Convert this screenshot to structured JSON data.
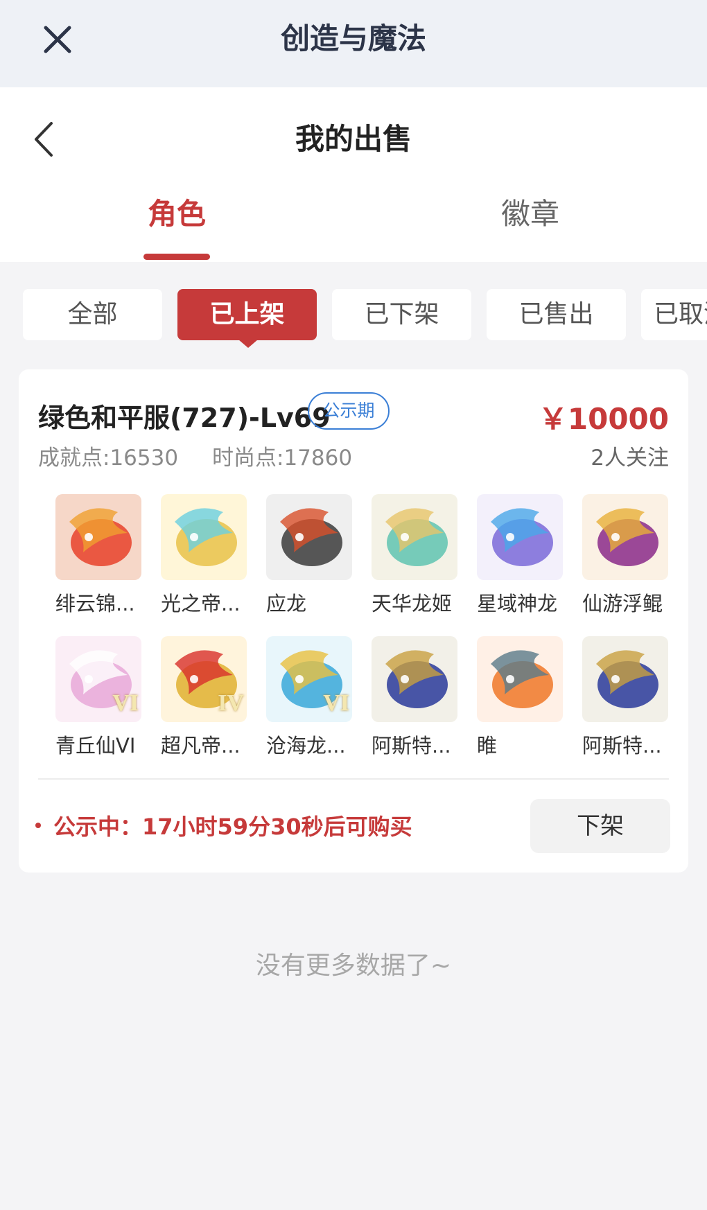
{
  "app_bar": {
    "title": "创造与魔法",
    "close_icon": "close-icon"
  },
  "header": {
    "title": "我的出售",
    "back_icon": "chevron-left-icon"
  },
  "tabs": [
    {
      "label": "角色",
      "active": true
    },
    {
      "label": "徽章",
      "active": false
    }
  ],
  "filters": [
    {
      "label": "全部",
      "active": false
    },
    {
      "label": "已上架",
      "active": true
    },
    {
      "label": "已下架",
      "active": false
    },
    {
      "label": "已售出",
      "active": false
    },
    {
      "label": "已取消",
      "active": false
    }
  ],
  "listing": {
    "title": "绿色和平服(727)-Lv69",
    "tag": "公示期",
    "price": "￥10000",
    "achievement_label": "成就点:",
    "achievement_value": "16530",
    "fashion_label": "时尚点:",
    "fashion_value": "17860",
    "followers": "2人关注",
    "mounts": [
      {
        "name": "绯云锦...",
        "colors": [
          "#f6d7c8",
          "#e8422a",
          "#f0a030"
        ],
        "badge": ""
      },
      {
        "name": "光之帝...",
        "colors": [
          "#fff6d8",
          "#e9c24a",
          "#6ad0e0"
        ],
        "badge": ""
      },
      {
        "name": "应龙",
        "colors": [
          "#efefef",
          "#3b3b3b",
          "#d8502a"
        ],
        "badge": ""
      },
      {
        "name": "天华龙姬",
        "colors": [
          "#f4f2e6",
          "#5fc4b0",
          "#e7c46a"
        ],
        "badge": ""
      },
      {
        "name": "星域神龙",
        "colors": [
          "#f3f0fb",
          "#7a6ad8",
          "#4aa8e8"
        ],
        "badge": ""
      },
      {
        "name": "仙游浮鲲",
        "colors": [
          "#fbf1e4",
          "#8a2a8a",
          "#e8b038"
        ],
        "badge": ""
      },
      {
        "name": "青丘仙VI",
        "colors": [
          "#fbeef6",
          "#e8a8d8",
          "#ffffff"
        ],
        "badge": "VI"
      },
      {
        "name": "超凡帝...",
        "colors": [
          "#fff4dc",
          "#e0b030",
          "#d8302a"
        ],
        "badge": "IV"
      },
      {
        "name": "沧海龙...",
        "colors": [
          "#e8f6fb",
          "#3aa8d8",
          "#e8c040"
        ],
        "badge": "VI"
      },
      {
        "name": "阿斯特...",
        "colors": [
          "#f2f0e8",
          "#2a3a9a",
          "#c8a040"
        ],
        "badge": ""
      },
      {
        "name": "睢",
        "colors": [
          "#fff0e6",
          "#f07828",
          "#5a7a8a"
        ],
        "badge": ""
      },
      {
        "name": "阿斯特...",
        "colors": [
          "#f2f0e8",
          "#2a3a9a",
          "#c8a040"
        ],
        "badge": ""
      }
    ],
    "notice": "公示中：17小时59分30秒后可购买",
    "action_label": "下架"
  },
  "footer_message": "没有更多数据了~",
  "colors": {
    "accent": "#c63a3a",
    "tag_blue": "#3b7fd6"
  }
}
